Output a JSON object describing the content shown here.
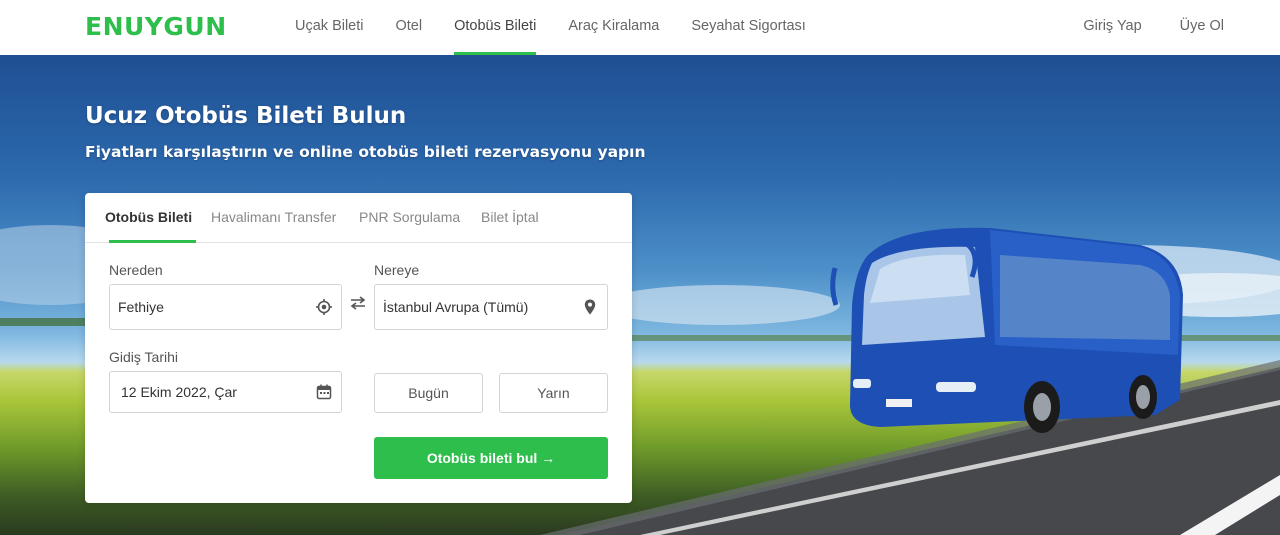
{
  "brand": {
    "logo": "ENUYGUN",
    "accent": "#2dbe4c"
  },
  "nav": [
    {
      "label": "Uçak Bileti"
    },
    {
      "label": "Otel"
    },
    {
      "label": "Otobüs Bileti",
      "active": true
    },
    {
      "label": "Araç Kiralama"
    },
    {
      "label": "Seyahat Sigortası"
    }
  ],
  "auth": {
    "login": "Giriş Yap",
    "register": "Üye Ol"
  },
  "hero": {
    "title": "Ucuz Otobüs Bileti Bulun",
    "subtitle": "Fiyatları karşılaştırın ve online otobüs bileti rezervasyonu yapın"
  },
  "search": {
    "tabs": [
      {
        "label": "Otobüs Bileti",
        "active": true
      },
      {
        "label": "Havalimanı Transfer"
      },
      {
        "label": "PNR Sorgulama"
      },
      {
        "label": "Bilet İptal"
      }
    ],
    "from_label": "Nereden",
    "from_value": "Fethiye",
    "to_label": "Nereye",
    "to_value": "İstanbul Avrupa (Tümü)",
    "date_label": "Gidiş Tarihi",
    "date_value": "12 Ekim 2022, Çar",
    "today": "Bugün",
    "tomorrow": "Yarın",
    "submit": "Otobüs bileti bul →"
  },
  "icons": {
    "from": "location-target-icon",
    "to": "map-pin-icon",
    "date": "calendar-icon",
    "swap": "swap-arrows-icon"
  }
}
